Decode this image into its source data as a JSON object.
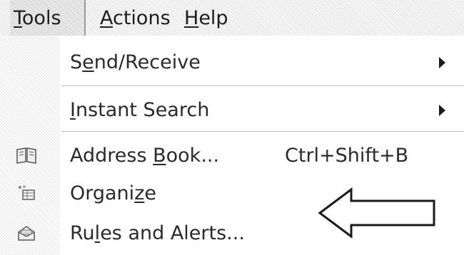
{
  "menubar": {
    "tools": {
      "underline": "T",
      "rest": "ools"
    },
    "actions": {
      "underline": "A",
      "rest": "ctions"
    },
    "help": {
      "underline": "H",
      "rest": "elp"
    }
  },
  "menu": {
    "items": [
      {
        "pre": "S",
        "underline": "e",
        "post": "nd/Receive",
        "shortcut": "",
        "submenu": true,
        "icon": ""
      },
      {
        "pre": "",
        "underline": "I",
        "post": "nstant Search",
        "shortcut": "",
        "submenu": true,
        "icon": ""
      },
      {
        "pre": "Address ",
        "underline": "B",
        "post": "ook...",
        "shortcut": "Ctrl+Shift+B",
        "submenu": false,
        "icon": "address-book-icon"
      },
      {
        "pre": "Organi",
        "underline": "z",
        "post": "e",
        "shortcut": "",
        "submenu": false,
        "icon": "organize-icon"
      },
      {
        "pre": "Ru",
        "underline": "l",
        "post": "es and Alerts...",
        "shortcut": "",
        "submenu": false,
        "icon": "rules-alerts-icon"
      }
    ]
  },
  "annotation": {
    "icon": "left-arrow-outline-icon",
    "points_to": "Organize"
  }
}
